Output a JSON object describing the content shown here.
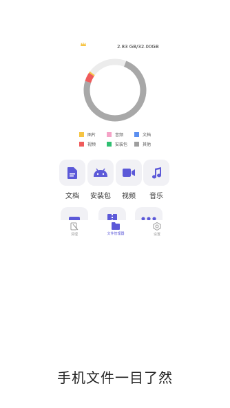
{
  "storage": {
    "used_total": "2.83 GB/32.00GB"
  },
  "legend": [
    {
      "label": "图片",
      "color": "#f6c443"
    },
    {
      "label": "音频",
      "color": "#f5a3c7"
    },
    {
      "label": "文档",
      "color": "#5b8ff0"
    },
    {
      "label": "视频",
      "color": "#ef5b5b"
    },
    {
      "label": "安装包",
      "color": "#2fbf71"
    },
    {
      "label": "其他",
      "color": "#9e9e9e"
    }
  ],
  "categories": [
    {
      "label": "文档",
      "icon": "document-icon"
    },
    {
      "label": "安装包",
      "icon": "android-icon"
    },
    {
      "label": "视频",
      "icon": "video-camera-icon"
    },
    {
      "label": "音乐",
      "icon": "music-note-icon"
    }
  ],
  "nav": [
    {
      "label": "清理",
      "icon": "clean-icon",
      "active": false
    },
    {
      "label": "文件管理器",
      "icon": "folder-icon",
      "active": true
    },
    {
      "label": "设置",
      "icon": "settings-icon",
      "active": false
    }
  ],
  "slogan": "手机文件一目了然",
  "colors": {
    "accent": "#5c59d8",
    "tile_bg": "#f1f1f5",
    "donut_other": "#a8a8a8",
    "donut_video": "#ef5b5b",
    "donut_remaining": "#ececec"
  }
}
